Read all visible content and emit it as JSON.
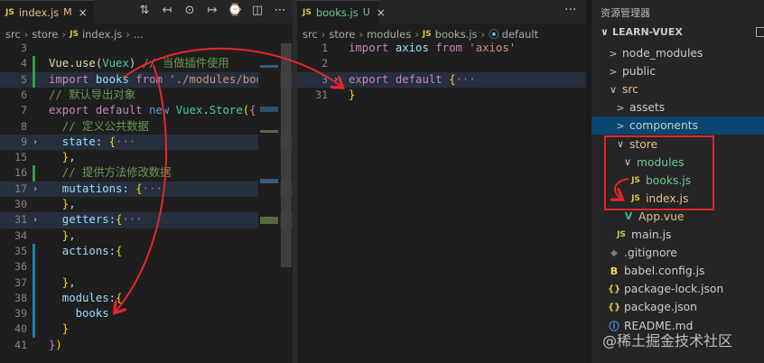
{
  "left_editor": {
    "tab": {
      "badge": "JS",
      "name": "index.js",
      "status": "M",
      "close": "×"
    },
    "toolbar_icons": [
      "source-control-icon",
      "go-back-icon",
      "circle-dot-icon",
      "go-forward-icon",
      "timeline-icon",
      "split-editor-icon",
      "more-icon"
    ],
    "toolbar_glyphs": [
      "⇅",
      "↤",
      "⊙",
      "↦",
      "⌚",
      "◫",
      "⋯"
    ],
    "breadcrumb": {
      "parts": [
        "src",
        "store"
      ],
      "badge": "JS",
      "file": "index.js",
      "tail": "..."
    },
    "lines": [
      {
        "num": "3",
        "tokens": []
      },
      {
        "num": "4",
        "tokens": [
          [
            "fn",
            "Vue"
          ],
          [
            "pn",
            "."
          ],
          [
            "fn",
            "use"
          ],
          [
            "pn",
            "("
          ],
          [
            "cls",
            "Vuex"
          ],
          [
            "pn",
            ")"
          ],
          [
            "cm",
            " // 当做插件使用"
          ]
        ]
      },
      {
        "num": "5",
        "tokens": [
          [
            "kw2",
            "import"
          ],
          [
            "pn",
            " "
          ],
          [
            "id",
            "books"
          ],
          [
            "pn",
            " "
          ],
          [
            "kw2",
            "from"
          ],
          [
            "pn",
            " "
          ],
          [
            "str",
            "'./modules/book"
          ]
        ]
      },
      {
        "num": "6",
        "tokens": [
          [
            "cm",
            "// 默认导出对象"
          ]
        ]
      },
      {
        "num": "7",
        "tokens": [
          [
            "kw2",
            "export"
          ],
          [
            "pn",
            " "
          ],
          [
            "kw2",
            "default"
          ],
          [
            "pn",
            " "
          ],
          [
            "kw",
            "new"
          ],
          [
            "pn",
            " "
          ],
          [
            "cls",
            "Vuex"
          ],
          [
            "pn",
            "."
          ],
          [
            "cls",
            "Store"
          ],
          [
            "br",
            "("
          ],
          [
            "br2",
            "{"
          ]
        ]
      },
      {
        "num": "8",
        "tokens": [
          [
            "cm",
            "  // 定义公共数据"
          ]
        ]
      },
      {
        "num": "9",
        "tokens": [
          [
            "id",
            "  state"
          ],
          [
            "pn",
            ": "
          ],
          [
            "br",
            "{"
          ],
          [
            "ell",
            "···"
          ]
        ]
      },
      {
        "num": "15",
        "tokens": [
          [
            "br",
            "  }"
          ],
          [
            "pn",
            ","
          ]
        ]
      },
      {
        "num": "16",
        "tokens": [
          [
            "cm",
            "  // 提供方法修改数据"
          ]
        ]
      },
      {
        "num": "17",
        "tokens": [
          [
            "id",
            "  mutations"
          ],
          [
            "pn",
            ": "
          ],
          [
            "br",
            "{"
          ],
          [
            "ell",
            "···"
          ]
        ]
      },
      {
        "num": "30",
        "tokens": [
          [
            "br",
            "  }"
          ],
          [
            "pn",
            ","
          ]
        ]
      },
      {
        "num": "31",
        "tokens": [
          [
            "id",
            "  getters"
          ],
          [
            "pn",
            ":"
          ],
          [
            "br",
            "{"
          ],
          [
            "ell",
            "···"
          ]
        ]
      },
      {
        "num": "34",
        "tokens": [
          [
            "br",
            "  }"
          ],
          [
            "pn",
            ","
          ]
        ]
      },
      {
        "num": "35",
        "tokens": [
          [
            "id",
            "  actions"
          ],
          [
            "pn",
            ":"
          ],
          [
            "br",
            "{"
          ]
        ]
      },
      {
        "num": "36",
        "tokens": []
      },
      {
        "num": "37",
        "tokens": [
          [
            "br",
            "  }"
          ],
          [
            "pn",
            ","
          ]
        ]
      },
      {
        "num": "38",
        "tokens": [
          [
            "id",
            "  modules"
          ],
          [
            "pn",
            ":"
          ],
          [
            "br",
            "{"
          ]
        ]
      },
      {
        "num": "39",
        "tokens": [
          [
            "id",
            "    books"
          ]
        ]
      },
      {
        "num": "40",
        "tokens": [
          [
            "br",
            "  }"
          ]
        ]
      },
      {
        "num": "41",
        "tokens": [
          [
            "br2",
            "}"
          ],
          [
            "br",
            ")"
          ]
        ]
      }
    ]
  },
  "right_editor": {
    "tab": {
      "badge": "JS",
      "name": "books.js",
      "status": "U",
      "close": "×"
    },
    "more": "···",
    "breadcrumb": {
      "parts": [
        "src",
        "store",
        "modules"
      ],
      "badge": "JS",
      "file": "books.js",
      "symbol_icon": "⦿",
      "symbol": "default"
    },
    "lines": [
      {
        "num": "1",
        "tokens": [
          [
            "kw2",
            "import"
          ],
          [
            "pn",
            " "
          ],
          [
            "id",
            "axios"
          ],
          [
            "pn",
            " "
          ],
          [
            "kw2",
            "from"
          ],
          [
            "pn",
            " "
          ],
          [
            "str",
            "'axios'"
          ]
        ]
      },
      {
        "num": "2",
        "tokens": []
      },
      {
        "num": "3",
        "tokens": [
          [
            "kw2",
            "export"
          ],
          [
            "pn",
            " "
          ],
          [
            "kw2",
            "default"
          ],
          [
            "pn",
            " "
          ],
          [
            "br",
            "{"
          ],
          [
            "ell",
            "···"
          ]
        ]
      },
      {
        "num": "31",
        "tokens": [
          [
            "br",
            "}"
          ]
        ]
      }
    ]
  },
  "explorer": {
    "header": "资源管理器",
    "folder": "LEARN-VUEX",
    "items": [
      {
        "label": "node_modules",
        "icon": ">",
        "icon_kind": "chevron",
        "color": "plain"
      },
      {
        "label": "public",
        "icon": ">",
        "icon_kind": "chevron",
        "color": "plain"
      },
      {
        "label": "src",
        "icon": "∨",
        "icon_kind": "chevron",
        "color": "mod"
      },
      {
        "label": "assets",
        "icon": ">",
        "icon_kind": "chevron",
        "color": "plain"
      },
      {
        "label": "components",
        "icon": ">",
        "icon_kind": "chevron",
        "color": "plain"
      },
      {
        "label": "store",
        "icon": "∨",
        "icon_kind": "chevron",
        "color": "mod"
      },
      {
        "label": "modules",
        "icon": "∨",
        "icon_kind": "chevron",
        "color": "git"
      },
      {
        "label": "books.js",
        "icon": "JS",
        "icon_kind": "js",
        "color": "git"
      },
      {
        "label": "index.js",
        "icon": "JS",
        "icon_kind": "js",
        "color": "mod"
      },
      {
        "label": "App.vue",
        "icon": "V",
        "icon_kind": "vue",
        "color": "mod"
      },
      {
        "label": "main.js",
        "icon": "JS",
        "icon_kind": "js",
        "color": "plain"
      },
      {
        "label": ".gitignore",
        "icon": "◆",
        "icon_kind": "git",
        "color": "plain"
      },
      {
        "label": "babel.config.js",
        "icon": "B",
        "icon_kind": "babel",
        "color": "plain"
      },
      {
        "label": "package-lock.json",
        "icon": "{}",
        "icon_kind": "json",
        "color": "plain"
      },
      {
        "label": "package.json",
        "icon": "{}",
        "icon_kind": "json",
        "color": "plain"
      },
      {
        "label": "README.md",
        "icon": "ⓘ",
        "icon_kind": "info",
        "color": "plain"
      }
    ],
    "selected_label": "components"
  },
  "watermark": "@稀土掘金技术社区",
  "colors": {
    "annotation_red": "#e8262a",
    "selection": "#094771"
  }
}
